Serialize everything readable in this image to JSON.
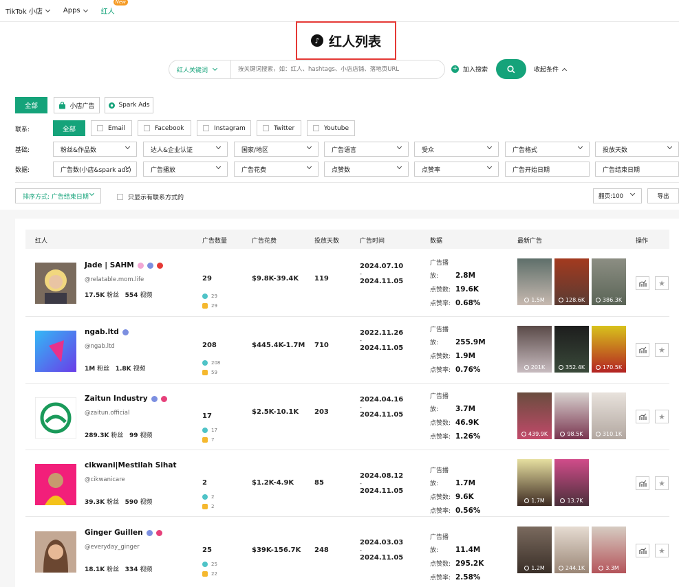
{
  "nav": {
    "items": [
      "TikTok 小店",
      "Apps",
      "红人"
    ],
    "new_badge": "New"
  },
  "page_title": "红人列表",
  "search": {
    "type_label": "红人关键词",
    "placeholder": "按关键词搜索，如：红人、hashtags、小店店铺、落地页URL",
    "add_label": "加入搜索",
    "collapse_label": "收起条件"
  },
  "ad_filters": {
    "all": "全部",
    "shop_ads": "小店广告",
    "spark_ads": "Spark Ads"
  },
  "contact": {
    "label": "联系:",
    "all": "全部",
    "options": [
      "Email",
      "Facebook",
      "Instagram",
      "Twitter",
      "Youtube"
    ]
  },
  "basic": {
    "label": "基础:",
    "dropdowns": [
      "粉丝&作品数",
      "达人&企业认证",
      "国家/地区",
      "广告语言",
      "受众",
      "广告格式",
      "投放天数"
    ]
  },
  "data_filters": {
    "label": "数据:",
    "dropdowns": [
      "广告数(小店&spark ads)",
      "广告播放",
      "广告花费",
      "点赞数",
      "点赞率"
    ],
    "start_date": "广告开始日期",
    "end_date": "广告结束日期"
  },
  "sort": {
    "label": "排序方式: 广告结束日期",
    "contact_only": "只显示有联系方式的",
    "page_size": "翻页:100",
    "export": "导出"
  },
  "table": {
    "headers": [
      "红人",
      "广告数量",
      "广告花费",
      "投放天数",
      "广告时间",
      "数据",
      "最新广告",
      "操作"
    ],
    "stat_labels": [
      "广告播放:",
      "点赞数:",
      "点赞率:"
    ],
    "fans_unit": "粉丝",
    "videos_unit": "视频",
    "dash": "-",
    "rows": [
      {
        "name": "Jade | SAHM",
        "handle": "@relatable.mom.life",
        "fans": "17.5K",
        "videos": "554",
        "ads": "29",
        "sub1": "29",
        "sub2": "29",
        "spend": "$9.8K-39.4K",
        "days": "119",
        "start": "2024.07.10",
        "end": "2024.11.05",
        "plays": "2.8M",
        "likes": "19.6K",
        "rate": "0.68%",
        "thumbs": [
          "1.5M",
          "128.6K",
          "386.3K"
        ]
      },
      {
        "name": "ngab.ltd",
        "handle": "@ngab.ltd",
        "fans": "1M",
        "videos": "1.8K",
        "ads": "208",
        "sub1": "208",
        "sub2": "59",
        "spend": "$445.4K-1.7M",
        "days": "710",
        "start": "2022.11.26",
        "end": "2024.11.05",
        "plays": "255.9M",
        "likes": "1.9M",
        "rate": "0.76%",
        "thumbs": [
          "201K",
          "352.4K",
          "170.5K"
        ]
      },
      {
        "name": "Zaitun Industry",
        "handle": "@zaitun.official",
        "fans": "289.3K",
        "videos": "99",
        "ads": "17",
        "sub1": "17",
        "sub2": "7",
        "spend": "$2.5K-10.1K",
        "days": "203",
        "start": "2024.04.16",
        "end": "2024.11.05",
        "plays": "3.7M",
        "likes": "46.9K",
        "rate": "1.26%",
        "thumbs": [
          "439.9K",
          "98.5K",
          "310.1K"
        ]
      },
      {
        "name": "cikwani|Mestilah Sihat",
        "handle": "@cikwanicare",
        "fans": "39.3K",
        "videos": "590",
        "ads": "2",
        "sub1": "2",
        "sub2": "2",
        "spend": "$1.2K-4.9K",
        "days": "85",
        "start": "2024.08.12",
        "end": "2024.11.05",
        "plays": "1.7M",
        "likes": "9.6K",
        "rate": "0.56%",
        "thumbs": [
          "1.7M",
          "13.7K"
        ]
      },
      {
        "name": "Ginger Guillen",
        "handle": "@everyday_ginger",
        "fans": "18.1K",
        "videos": "334",
        "ads": "25",
        "sub1": "25",
        "sub2": "22",
        "spend": "$39K-156.7K",
        "days": "248",
        "start": "2024.03.03",
        "end": "2024.11.05",
        "plays": "11.4M",
        "likes": "295.2K",
        "rate": "2.58%",
        "thumbs": [
          "1.2M",
          "244.1K",
          "3.3M"
        ]
      }
    ]
  },
  "colors": {
    "accent": "#15a37a",
    "highlight_box": "#e53935",
    "new_badge": "#f59a23"
  }
}
